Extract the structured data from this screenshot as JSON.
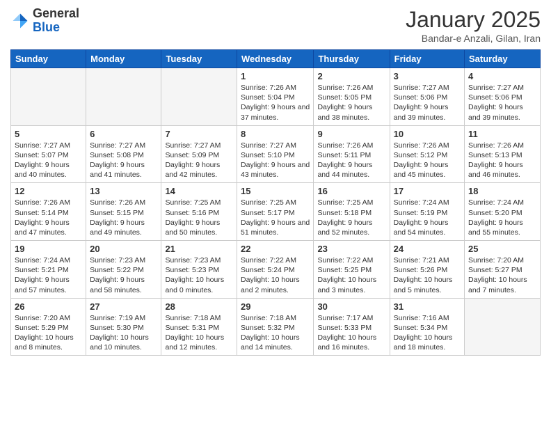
{
  "header": {
    "logo_general": "General",
    "logo_blue": "Blue",
    "month_title": "January 2025",
    "location": "Bandar-e Anzali, Gilan, Iran"
  },
  "days_of_week": [
    "Sunday",
    "Monday",
    "Tuesday",
    "Wednesday",
    "Thursday",
    "Friday",
    "Saturday"
  ],
  "weeks": [
    [
      {
        "day": "",
        "info": ""
      },
      {
        "day": "",
        "info": ""
      },
      {
        "day": "",
        "info": ""
      },
      {
        "day": "1",
        "info": "Sunrise: 7:26 AM\nSunset: 5:04 PM\nDaylight: 9 hours and 37 minutes."
      },
      {
        "day": "2",
        "info": "Sunrise: 7:26 AM\nSunset: 5:05 PM\nDaylight: 9 hours and 38 minutes."
      },
      {
        "day": "3",
        "info": "Sunrise: 7:27 AM\nSunset: 5:06 PM\nDaylight: 9 hours and 39 minutes."
      },
      {
        "day": "4",
        "info": "Sunrise: 7:27 AM\nSunset: 5:06 PM\nDaylight: 9 hours and 39 minutes."
      }
    ],
    [
      {
        "day": "5",
        "info": "Sunrise: 7:27 AM\nSunset: 5:07 PM\nDaylight: 9 hours and 40 minutes."
      },
      {
        "day": "6",
        "info": "Sunrise: 7:27 AM\nSunset: 5:08 PM\nDaylight: 9 hours and 41 minutes."
      },
      {
        "day": "7",
        "info": "Sunrise: 7:27 AM\nSunset: 5:09 PM\nDaylight: 9 hours and 42 minutes."
      },
      {
        "day": "8",
        "info": "Sunrise: 7:27 AM\nSunset: 5:10 PM\nDaylight: 9 hours and 43 minutes."
      },
      {
        "day": "9",
        "info": "Sunrise: 7:26 AM\nSunset: 5:11 PM\nDaylight: 9 hours and 44 minutes."
      },
      {
        "day": "10",
        "info": "Sunrise: 7:26 AM\nSunset: 5:12 PM\nDaylight: 9 hours and 45 minutes."
      },
      {
        "day": "11",
        "info": "Sunrise: 7:26 AM\nSunset: 5:13 PM\nDaylight: 9 hours and 46 minutes."
      }
    ],
    [
      {
        "day": "12",
        "info": "Sunrise: 7:26 AM\nSunset: 5:14 PM\nDaylight: 9 hours and 47 minutes."
      },
      {
        "day": "13",
        "info": "Sunrise: 7:26 AM\nSunset: 5:15 PM\nDaylight: 9 hours and 49 minutes."
      },
      {
        "day": "14",
        "info": "Sunrise: 7:25 AM\nSunset: 5:16 PM\nDaylight: 9 hours and 50 minutes."
      },
      {
        "day": "15",
        "info": "Sunrise: 7:25 AM\nSunset: 5:17 PM\nDaylight: 9 hours and 51 minutes."
      },
      {
        "day": "16",
        "info": "Sunrise: 7:25 AM\nSunset: 5:18 PM\nDaylight: 9 hours and 52 minutes."
      },
      {
        "day": "17",
        "info": "Sunrise: 7:24 AM\nSunset: 5:19 PM\nDaylight: 9 hours and 54 minutes."
      },
      {
        "day": "18",
        "info": "Sunrise: 7:24 AM\nSunset: 5:20 PM\nDaylight: 9 hours and 55 minutes."
      }
    ],
    [
      {
        "day": "19",
        "info": "Sunrise: 7:24 AM\nSunset: 5:21 PM\nDaylight: 9 hours and 57 minutes."
      },
      {
        "day": "20",
        "info": "Sunrise: 7:23 AM\nSunset: 5:22 PM\nDaylight: 9 hours and 58 minutes."
      },
      {
        "day": "21",
        "info": "Sunrise: 7:23 AM\nSunset: 5:23 PM\nDaylight: 10 hours and 0 minutes."
      },
      {
        "day": "22",
        "info": "Sunrise: 7:22 AM\nSunset: 5:24 PM\nDaylight: 10 hours and 2 minutes."
      },
      {
        "day": "23",
        "info": "Sunrise: 7:22 AM\nSunset: 5:25 PM\nDaylight: 10 hours and 3 minutes."
      },
      {
        "day": "24",
        "info": "Sunrise: 7:21 AM\nSunset: 5:26 PM\nDaylight: 10 hours and 5 minutes."
      },
      {
        "day": "25",
        "info": "Sunrise: 7:20 AM\nSunset: 5:27 PM\nDaylight: 10 hours and 7 minutes."
      }
    ],
    [
      {
        "day": "26",
        "info": "Sunrise: 7:20 AM\nSunset: 5:29 PM\nDaylight: 10 hours and 8 minutes."
      },
      {
        "day": "27",
        "info": "Sunrise: 7:19 AM\nSunset: 5:30 PM\nDaylight: 10 hours and 10 minutes."
      },
      {
        "day": "28",
        "info": "Sunrise: 7:18 AM\nSunset: 5:31 PM\nDaylight: 10 hours and 12 minutes."
      },
      {
        "day": "29",
        "info": "Sunrise: 7:18 AM\nSunset: 5:32 PM\nDaylight: 10 hours and 14 minutes."
      },
      {
        "day": "30",
        "info": "Sunrise: 7:17 AM\nSunset: 5:33 PM\nDaylight: 10 hours and 16 minutes."
      },
      {
        "day": "31",
        "info": "Sunrise: 7:16 AM\nSunset: 5:34 PM\nDaylight: 10 hours and 18 minutes."
      },
      {
        "day": "",
        "info": ""
      }
    ]
  ]
}
